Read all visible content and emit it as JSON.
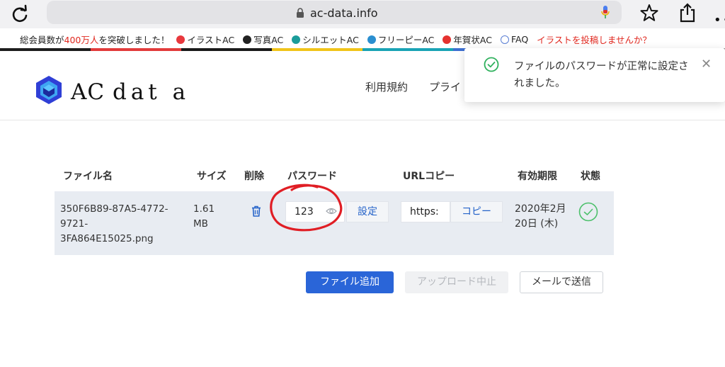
{
  "browser": {
    "url": "ac-data.info"
  },
  "acbar": {
    "promo_prefix": "総会員数が",
    "promo_highlight": "400万人",
    "promo_suffix": "を突破しました！",
    "links": [
      "イラストAC",
      "写真AC",
      "シルエットAC",
      "フリーピーAC",
      "年賀状AC",
      "FAQ"
    ],
    "post_link": "イラストを投稿しませんか？"
  },
  "header": {
    "logo_ac": "AC",
    "logo_rest": "dat a",
    "nav": [
      "利用規約",
      "プライ"
    ]
  },
  "toast": {
    "message": "ファイルのパスワードが正常に設定されました。",
    "close_glyph": "✕"
  },
  "table": {
    "headers": {
      "filename": "ファイル名",
      "size": "サイズ",
      "delete": "削除",
      "password": "パスワード",
      "url_copy": "URLコピー",
      "expiry": "有効期限",
      "status": "状態"
    },
    "row": {
      "filename_lines": [
        "350F6B89-87A5-4772-",
        "9721-",
        "3FA864E15025.png"
      ],
      "size_lines": [
        "1.61",
        "MB"
      ],
      "password": "123",
      "set_label": "設定",
      "url_value": "https:",
      "copy_label": "コピー",
      "expiry_lines": [
        "2020年2月",
        "20日 (木)"
      ]
    }
  },
  "actions": {
    "add_file": "ファイル追加",
    "stop_upload": "アップロード中止",
    "send_mail": "メールで送信"
  },
  "colors": {
    "primary": "#2a65d8",
    "success": "#2fb15d",
    "annotation": "#e01e25"
  }
}
